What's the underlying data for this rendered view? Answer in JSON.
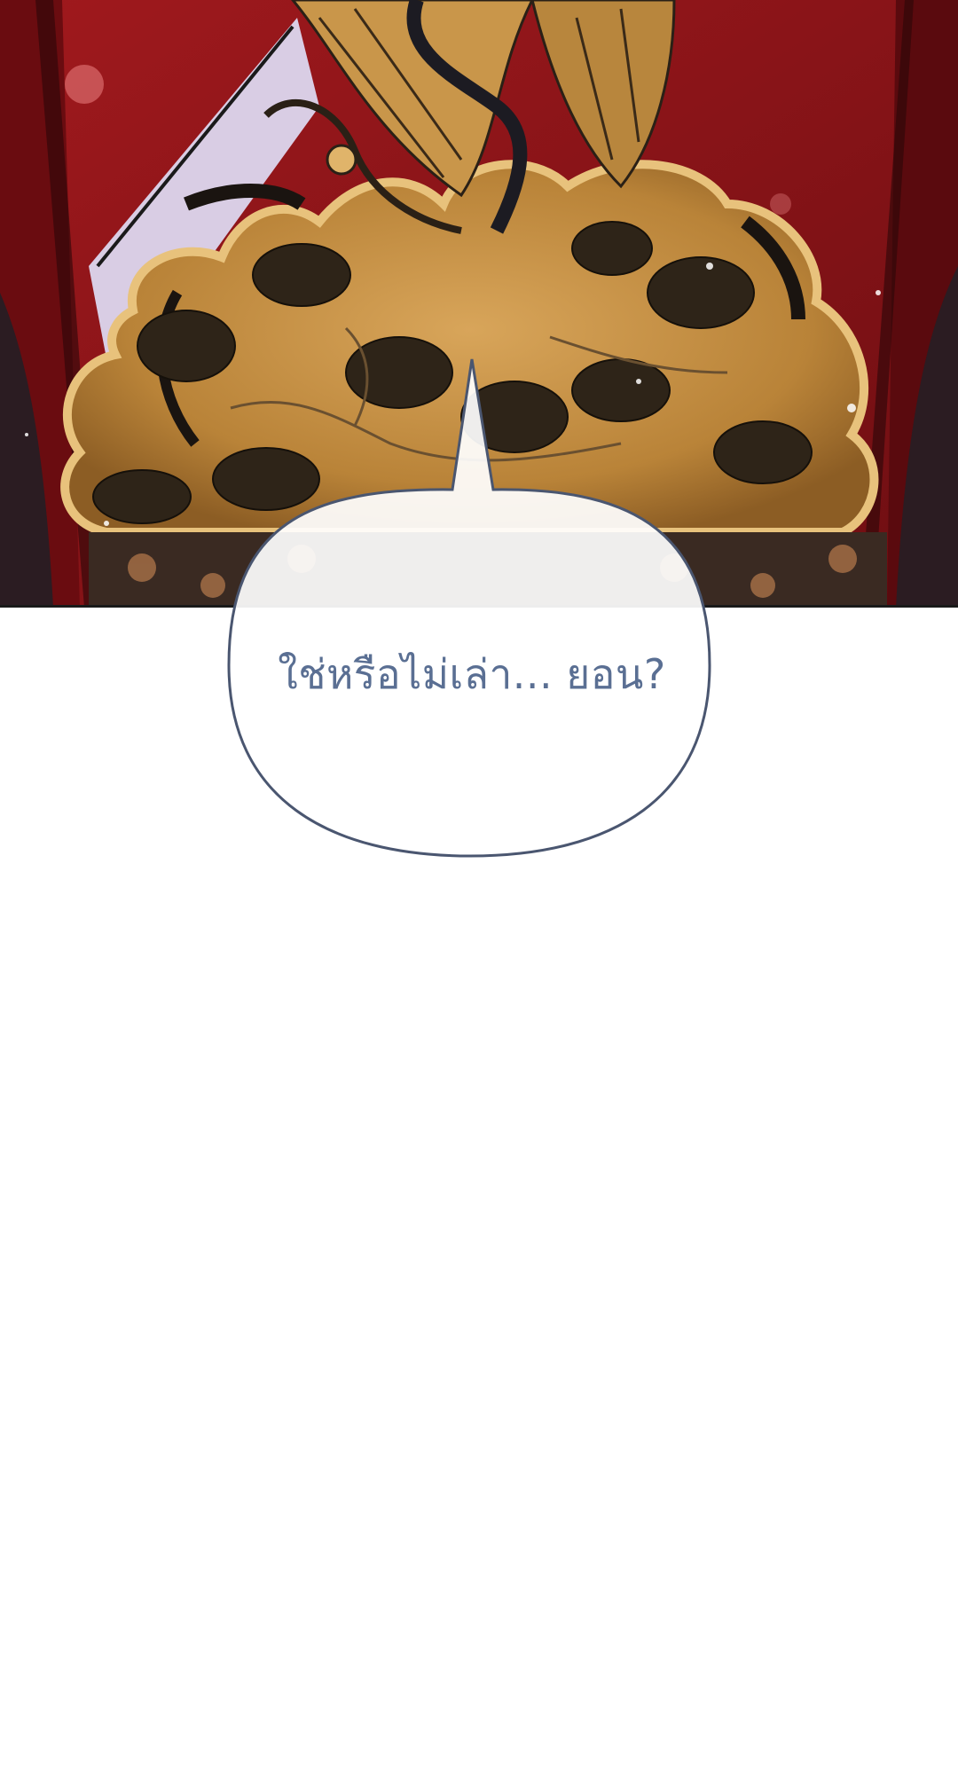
{
  "panel": {
    "artwork": "illustrated-golden-crane-pine-embroidery-on-red-robe",
    "colors": {
      "robe_red": "#8f1519",
      "robe_dark": "#5a0c10",
      "gold": "#c48c3c",
      "gold_light": "#e0b46a",
      "ink": "#2a2016",
      "collar": "#d9cde4",
      "sash": "#3a2a22",
      "sash_pattern": "#b0764a"
    }
  },
  "speech_bubble": {
    "text": "ใช่หรือไม่เล่า... ยอน?",
    "text_color": "#5a6f93",
    "border_color": "#4a5670",
    "fill_color": "#ffffff"
  }
}
